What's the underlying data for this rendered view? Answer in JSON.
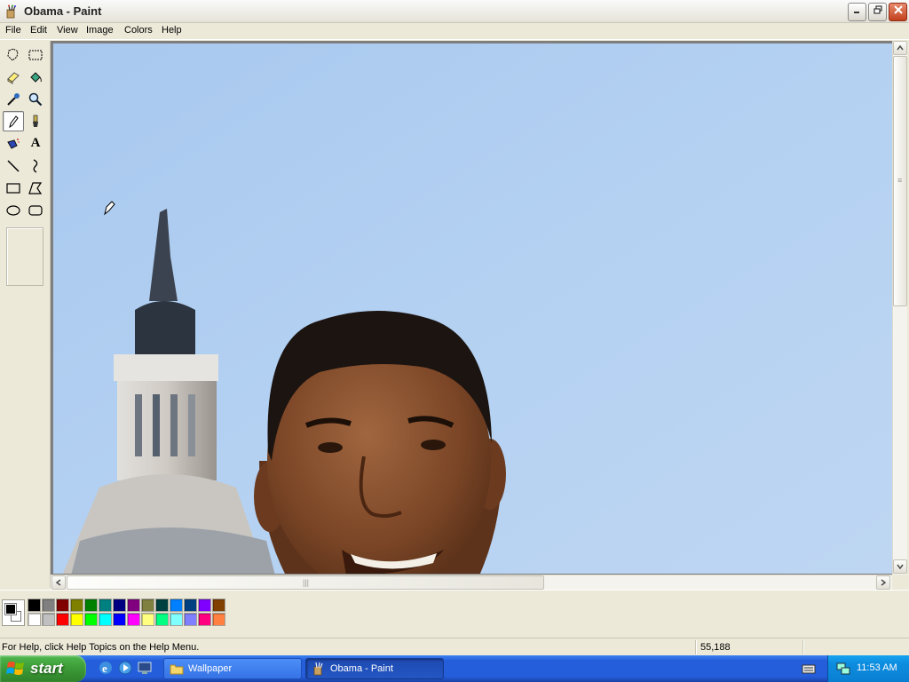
{
  "window": {
    "title": "Obama - Paint"
  },
  "menu": [
    "File",
    "Edit",
    "View",
    "Image",
    "Colors",
    "Help"
  ],
  "tools": [
    {
      "name": "free-form-select-icon",
      "selected": false
    },
    {
      "name": "rect-select-icon",
      "selected": false
    },
    {
      "name": "eraser-icon",
      "selected": false
    },
    {
      "name": "fill-bucket-icon",
      "selected": false
    },
    {
      "name": "pick-color-icon",
      "selected": false
    },
    {
      "name": "magnifier-icon",
      "selected": false
    },
    {
      "name": "pencil-icon",
      "selected": true
    },
    {
      "name": "brush-icon",
      "selected": false
    },
    {
      "name": "airbrush-icon",
      "selected": false
    },
    {
      "name": "text-icon",
      "selected": false
    },
    {
      "name": "line-icon",
      "selected": false
    },
    {
      "name": "curve-icon",
      "selected": false
    },
    {
      "name": "rectangle-icon",
      "selected": false
    },
    {
      "name": "polygon-icon",
      "selected": false
    },
    {
      "name": "ellipse-icon",
      "selected": false
    },
    {
      "name": "rounded-rect-icon",
      "selected": false
    }
  ],
  "text_tool_glyph": "A",
  "palette": {
    "foreground": "#000000",
    "background": "#ffffff",
    "top_row": [
      "#000000",
      "#808080",
      "#800000",
      "#808000",
      "#008000",
      "#008080",
      "#000080",
      "#800080",
      "#808040",
      "#004040",
      "#0080ff",
      "#004080",
      "#8000ff",
      "#804000"
    ],
    "bottom_row": [
      "#ffffff",
      "#c0c0c0",
      "#ff0000",
      "#ffff00",
      "#00ff00",
      "#00ffff",
      "#0000ff",
      "#ff00ff",
      "#ffff80",
      "#00ff80",
      "#80ffff",
      "#8080ff",
      "#ff0080",
      "#ff8040"
    ]
  },
  "status": {
    "help_text": "For Help, click Help Topics on the Help Menu.",
    "coords": "55,188"
  },
  "taskbar": {
    "start_label": "start",
    "tasks": [
      {
        "label": "Wallpaper",
        "active": false
      },
      {
        "label": "Obama - Paint",
        "active": true
      }
    ],
    "clock": "11:53 AM"
  },
  "colors": {
    "sky": "#b0cdf0",
    "xp_blue": "#245edb",
    "start_green": "#3c9a37"
  }
}
